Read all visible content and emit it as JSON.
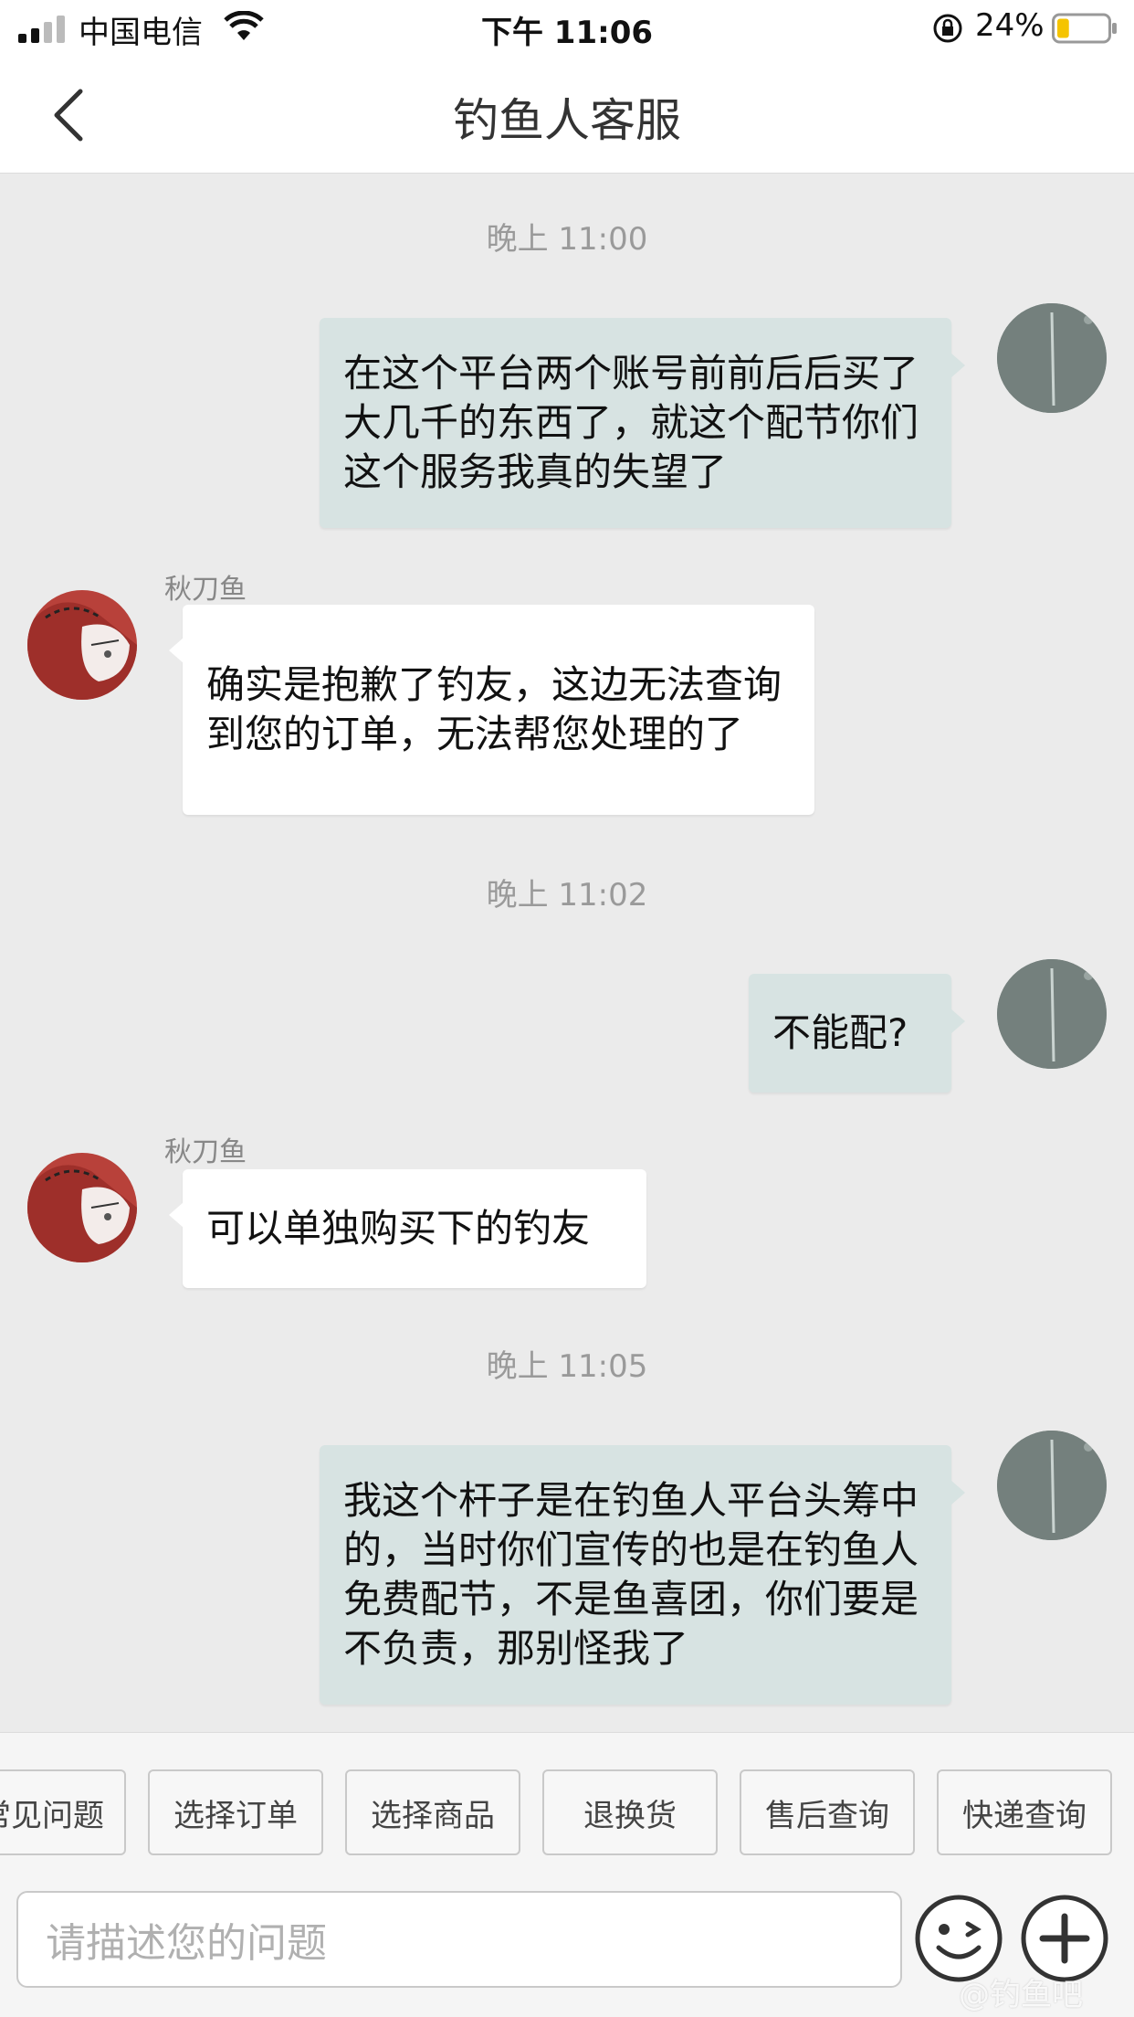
{
  "status_bar": {
    "carrier": "中国电信",
    "time": "下午 11:06",
    "battery_percent": "24%",
    "battery_level": 0.24
  },
  "header": {
    "title": "钓鱼人客服"
  },
  "chat": {
    "time_1": "晚上 11:00",
    "msg_1": "在这个平台两个账号前前后后买了大几千的东西了，就这个配节你们这个服务我真的失望了",
    "sender_1": "秋刀鱼",
    "msg_2": "确实是抱歉了钓友，这边无法查询到您的订单，无法帮您处理的了",
    "time_2": "晚上 11:02",
    "msg_3": "不能配?",
    "sender_2": "秋刀鱼",
    "msg_4": "可以单独购买下的钓友",
    "time_3": "晚上 11:05",
    "msg_5": "我这个杆子是在钓鱼人平台头筹中的，当时你们宣传的也是在钓鱼人免费配节，不是鱼喜团，你们要是不负责，那别怪我了"
  },
  "quick_replies": [
    "常见问题",
    "选择订单",
    "选择商品",
    "退换货",
    "售后查询",
    "快递查询"
  ],
  "input": {
    "placeholder": "请描述您的问题"
  },
  "watermark": "@钓鱼吧",
  "colors": {
    "outgoing_bubble": "#d7e3e2",
    "incoming_bubble": "#ffffff",
    "chat_background": "#ebebeb"
  }
}
